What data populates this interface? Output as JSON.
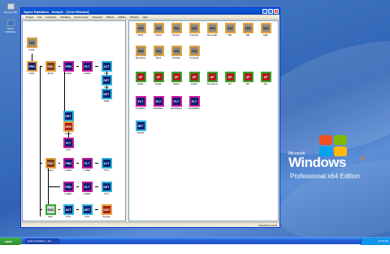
{
  "desktop": {
    "icons": [
      {
        "label": "Recycle Bin"
      },
      {
        "label": "Space Radiation"
      }
    ]
  },
  "xp_logo": {
    "microsoft": "Microsoft",
    "windows": "Windows",
    "xp": "xp",
    "edition": "Professional x64 Edition"
  },
  "window": {
    "title": "Space Radiation - Sample - [View Window]",
    "menu": [
      "Project",
      "File",
      "Functions",
      "Shielding",
      "Environment",
      "Transport",
      "Effects",
      "Utilities",
      "Window",
      "Help"
    ],
    "status": "2011/01/11 11:00"
  },
  "colors": {
    "orange": "#e6a23c",
    "magenta": "#c8189c",
    "green": "#2fa82f",
    "cyan": "#2ab4d8",
    "shd": "#8c8a86",
    "prd": "#0a1e73",
    "env": "#7a3c1e",
    "ker": "#b01c1c",
    "rad": "#d4d7da"
  },
  "left_nodes": [
    {
      "label": "Cub1",
      "tag": "SHD"
    },
    {
      "label": "Cub1",
      "tag": "PRD"
    },
    {
      "label": "Shd2",
      "tag": "ENV"
    },
    {
      "label": "LeftE1",
      "tag": "PRD"
    },
    {
      "label": "LeftE2",
      "tag": "FLT"
    },
    {
      "label": "ST1",
      "tag": "ACT"
    },
    {
      "label": "Rad",
      "tag": "DET"
    },
    {
      "label": "DHM",
      "tag": "DET"
    },
    {
      "label": "ST2",
      "tag": "DET"
    },
    {
      "label": "ST2",
      "tag": "FLT"
    },
    {
      "label": "Stdam",
      "tag": "KER"
    },
    {
      "label": "Stay1",
      "tag": "ENV"
    },
    {
      "label": "LeftE1",
      "tag": "PRD"
    },
    {
      "label": "LeftE2",
      "tag": "FLT"
    },
    {
      "label": "ST3",
      "tag": "ACT"
    },
    {
      "label": "LeftE1",
      "tag": "PRD"
    },
    {
      "label": "LeftE2",
      "tag": "FLT"
    },
    {
      "label": "ST4",
      "tag": "DET"
    },
    {
      "label": "Earl",
      "tag": "RAD"
    },
    {
      "label": "ST5",
      "tag": "ACT"
    },
    {
      "label": "ST5",
      "tag": "DET"
    },
    {
      "label": "Supply",
      "tag": "KER"
    }
  ],
  "right_nodes": [
    {
      "label": "Shd1",
      "tag": "SHD"
    },
    {
      "label": "Shd2",
      "tag": "SHD"
    },
    {
      "label": "Sphere",
      "tag": "SHD"
    },
    {
      "label": "Cylinder",
      "tag": "SHD"
    },
    {
      "label": "Boundall",
      "tag": "SHD"
    },
    {
      "label": "Bf1",
      "tag": "SHD"
    },
    {
      "label": "Bf2",
      "tag": "SHD"
    },
    {
      "label": "Slab",
      "tag": "SHD"
    },
    {
      "label": "Business",
      "tag": "SHD"
    },
    {
      "label": "Sky1",
      "tag": "SHD"
    },
    {
      "label": "Double",
      "tag": "SHD"
    },
    {
      "label": "Complex",
      "tag": "SHD"
    },
    {
      "label": "Rad1",
      "tag": "AP"
    },
    {
      "label": "Rad2",
      "tag": "AP"
    },
    {
      "label": "Rad3",
      "tag": "AP"
    },
    {
      "label": "Rad4",
      "tag": "AP"
    },
    {
      "label": "Compund",
      "tag": "AP"
    },
    {
      "label": "R1",
      "tag": "AP"
    },
    {
      "label": "R2",
      "tag": "AP"
    },
    {
      "label": "R3",
      "tag": "AP"
    },
    {
      "label": "P100Mev",
      "tag": "FLT"
    },
    {
      "label": "E300Mev",
      "tag": "FLT"
    },
    {
      "label": "H1000Mev",
      "tag": "FLT"
    },
    {
      "label": "G1000Mev",
      "tag": "FLT"
    },
    {
      "label": "Rk100",
      "tag": "DET"
    }
  ],
  "taskbar": {
    "start": "start",
    "task": "Space Radiation - Sa...",
    "clock": "11:00 AM"
  }
}
